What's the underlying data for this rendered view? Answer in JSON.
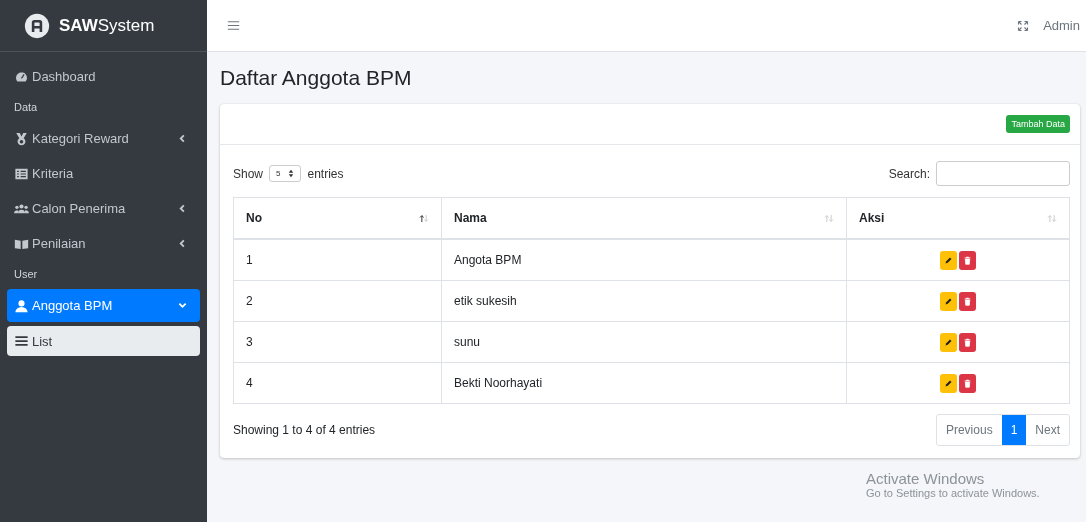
{
  "brand": {
    "name": "**SAW**System"
  },
  "sidebar": {
    "items": [
      {
        "kind": "link",
        "label": "Dashboard",
        "selected": false
      },
      {
        "kind": "header",
        "label": "Data"
      },
      {
        "kind": "link",
        "label": "Kategori Reward",
        "selected": false,
        "expanded": false
      },
      {
        "kind": "link",
        "label": "Kriteria",
        "selected": false
      },
      {
        "kind": "link",
        "label": "Calon Penerima",
        "selected": false,
        "expanded": false
      },
      {
        "kind": "link",
        "label": "Penilaian",
        "selected": false,
        "expanded": false
      },
      {
        "kind": "header",
        "label": "User"
      },
      {
        "kind": "link",
        "label": "Anggota BPM",
        "selected": true,
        "expanded": true,
        "children": [
          {
            "label": "List",
            "selected": true
          }
        ]
      }
    ]
  },
  "topbar": {
    "user": "Admin"
  },
  "page": {
    "title": "Daftar Anggota BPM"
  },
  "card": {
    "add_button": "Tambah Data",
    "length": {
      "before": "Show",
      "value": "5",
      "after": "entries"
    },
    "search": {
      "label": "Search:"
    },
    "table": {
      "columns": [
        {
          "label": "No",
          "sorted": true
        },
        {
          "label": "Nama",
          "sorted": false
        },
        {
          "label": "Aksi",
          "sorted": false
        }
      ],
      "rows": [
        {
          "no": "1",
          "nama": "Angota BPM"
        },
        {
          "no": "2",
          "nama": "etik sukesih"
        },
        {
          "no": "3",
          "nama": "sunu"
        },
        {
          "no": "4",
          "nama": "Bekti Noorhayati"
        }
      ]
    },
    "info": "Showing 1 to 4 of 4 entries",
    "pagination": {
      "previous": "Previous",
      "pages": [
        {
          "label": "1",
          "selected": true
        }
      ],
      "next": "Next"
    }
  },
  "os_notice": {
    "title": "Activate Windows",
    "text": "Go to Settings to activate Windows."
  }
}
